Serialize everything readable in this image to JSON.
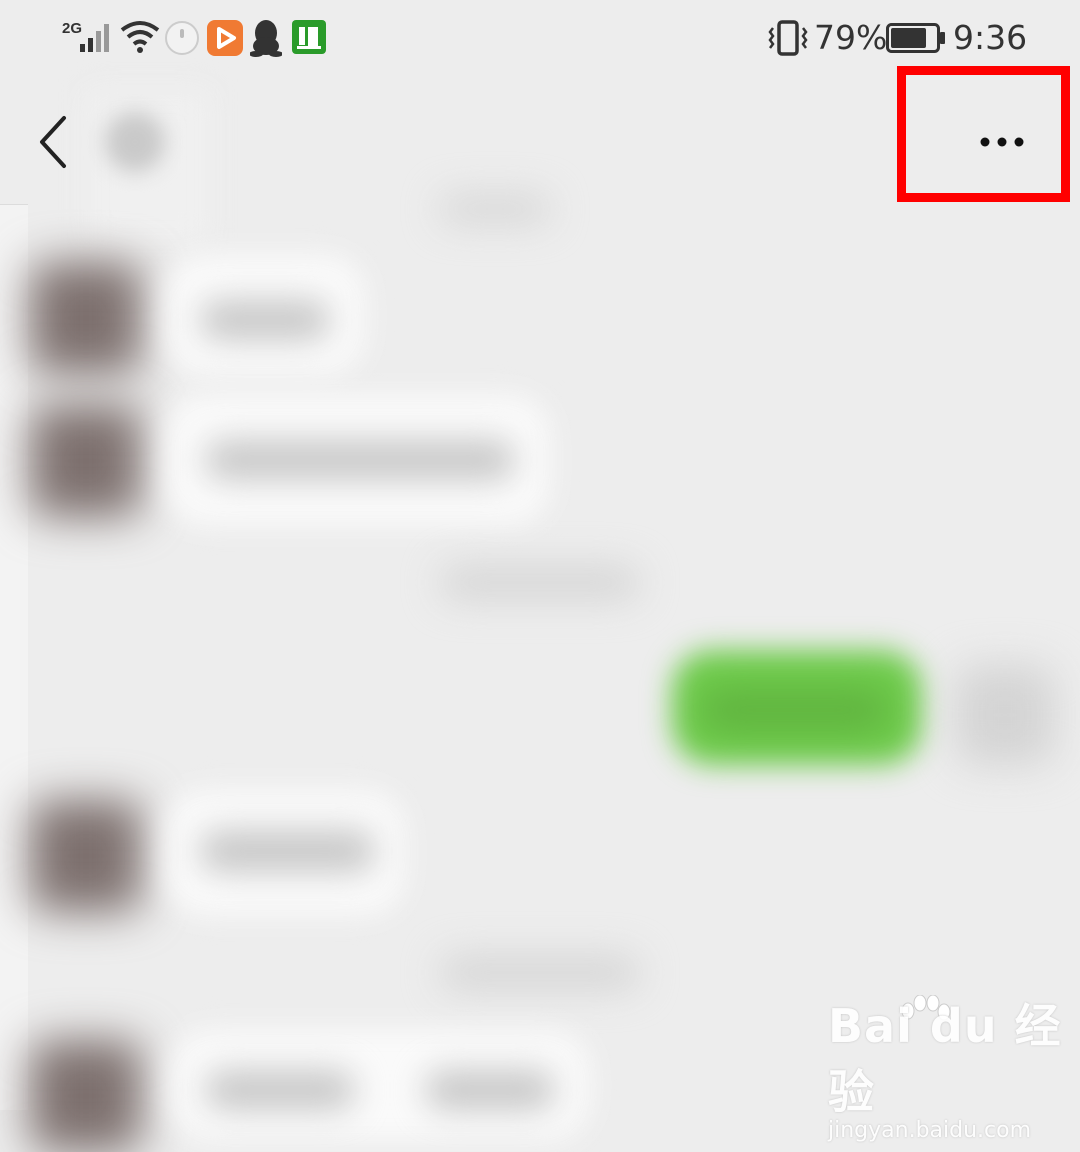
{
  "status_bar": {
    "network_type": "2G",
    "battery_percent": "79%",
    "time": "9:36",
    "notification_icons": [
      "signal-icon",
      "wifi-icon",
      "round-app-icon",
      "video-app-icon",
      "qq-penguin-icon",
      "green-app-icon"
    ],
    "battery_level": 0.79
  },
  "nav": {
    "back_icon": "chevron-left-icon",
    "more_icon": "more-dots-icon"
  },
  "highlight_color": "#ff0000",
  "watermark": {
    "brand": "Bai du 经验",
    "url": "jingyan.baidu.com"
  }
}
